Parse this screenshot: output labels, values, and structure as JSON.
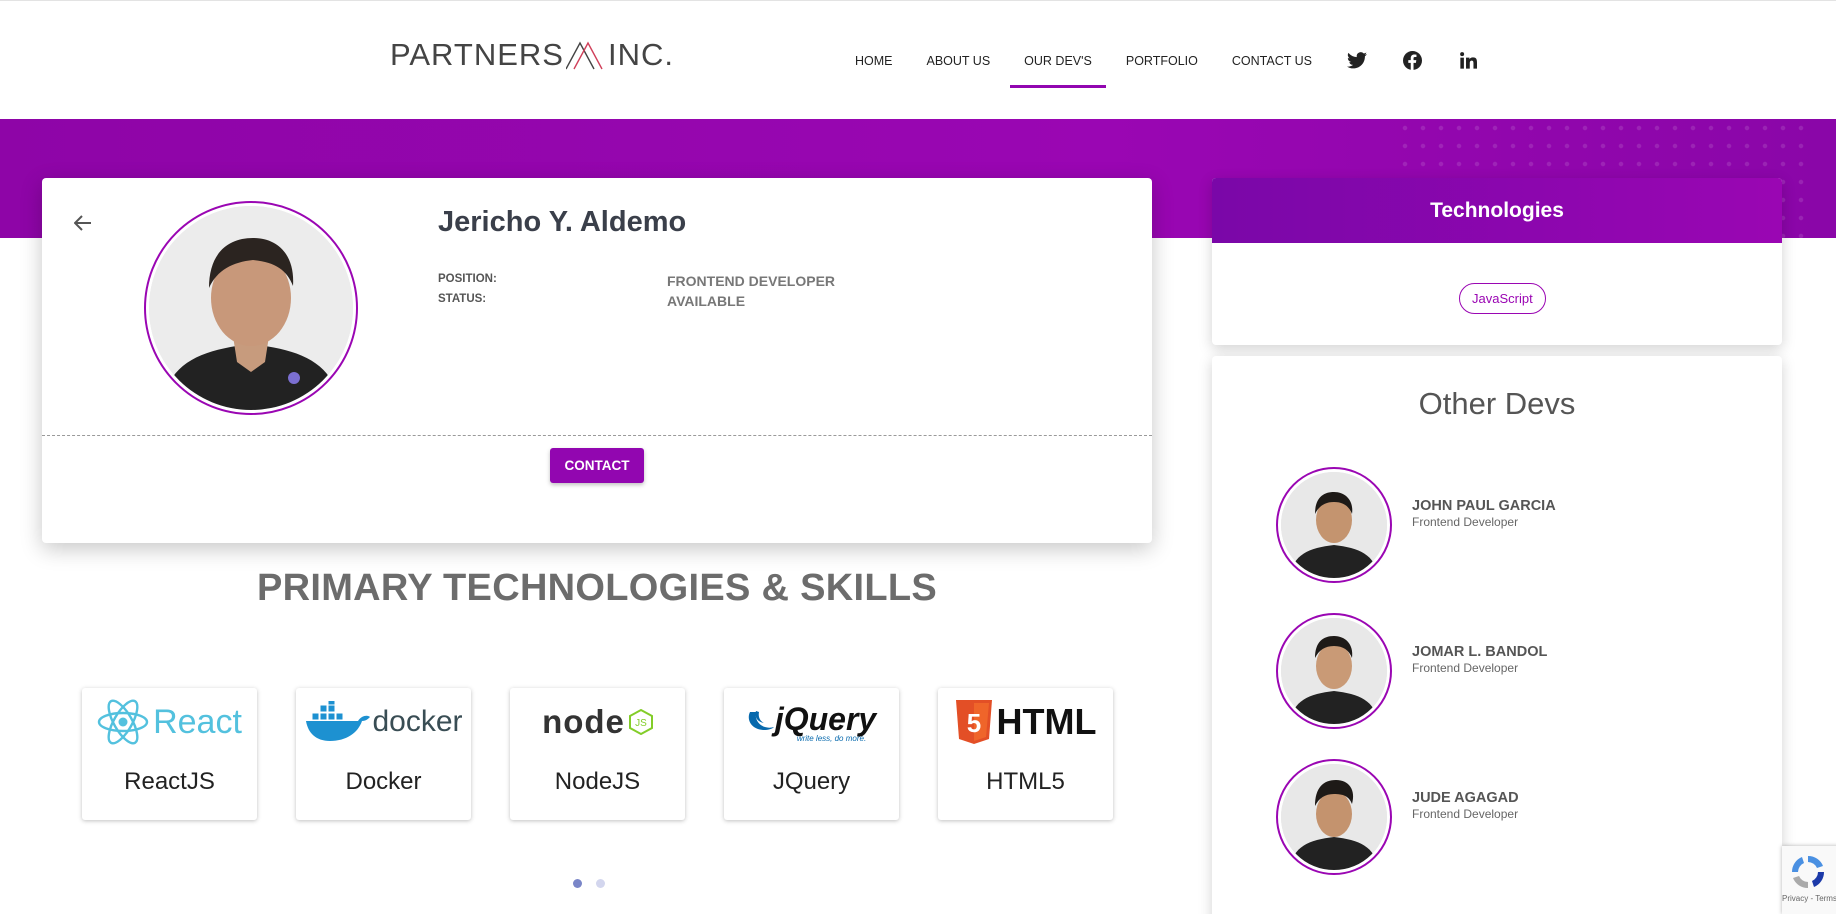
{
  "logo": {
    "left": "PARTNERS",
    "right": "INC."
  },
  "nav": {
    "items": [
      "HOME",
      "ABOUT US",
      "OUR DEV'S",
      "PORTFOLIO",
      "CONTACT US"
    ],
    "active": "OUR DEV'S",
    "social": [
      "twitter-icon",
      "facebook-icon",
      "linkedin-icon"
    ]
  },
  "profile": {
    "name": "Jericho Y. Aldemo",
    "position_label": "POSITION:",
    "position_value": "FRONTEND DEVELOPER",
    "status_label": "STATUS:",
    "status_value": "AVAILABLE",
    "contact_label": "CONTACT"
  },
  "skills": {
    "title": "PRIMARY TECHNOLOGIES & SKILLS",
    "items": [
      {
        "name": "ReactJS",
        "logo_text": "React"
      },
      {
        "name": "Docker",
        "logo_text": "docker"
      },
      {
        "name": "NodeJS",
        "logo_text": "node"
      },
      {
        "name": "JQuery",
        "logo_text": "jQuery",
        "logo_sub": "write less, do more."
      },
      {
        "name": "HTML5",
        "logo_text": "HTML",
        "logo_badge": "5"
      }
    ]
  },
  "technologies": {
    "title": "Technologies",
    "chips": [
      "JavaScript"
    ]
  },
  "other_devs": {
    "title": "Other Devs",
    "devs": [
      {
        "name": "JOHN PAUL GARCIA",
        "role": "Frontend Developer"
      },
      {
        "name": "JOMAR L. BANDOL",
        "role": "Frontend Developer"
      },
      {
        "name": "JUDE AGAGAD",
        "role": "Frontend Developer"
      }
    ]
  },
  "recaptcha": {
    "text": "Privacy - Terms"
  },
  "colors": {
    "brand": "#9206b0",
    "brand_dark": "#7a07a8"
  }
}
